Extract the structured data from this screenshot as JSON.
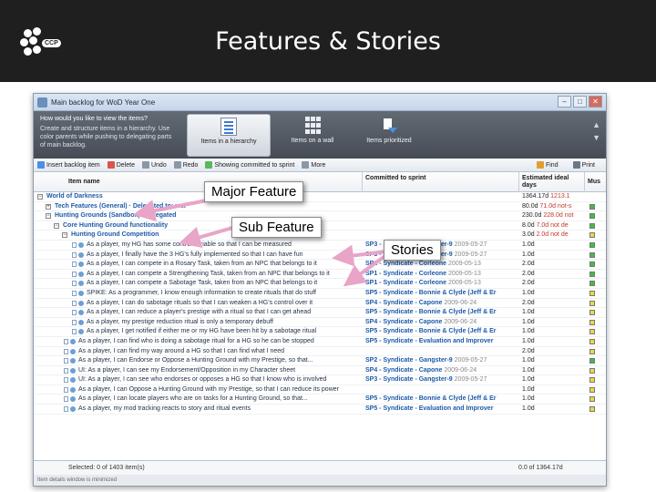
{
  "slide": {
    "title": "Features & Stories",
    "logo_text": "CCP"
  },
  "window": {
    "title": "Main backlog for WoD Year One",
    "controls": [
      "–",
      "□",
      "✕"
    ]
  },
  "ribbon": {
    "question": "How would you like to view the items?",
    "description": "Create and structure items in a hierarchy. Use color parents while pushing to delegating parts of main backlog.",
    "views": [
      {
        "label": "Items in a hierarchy",
        "icon": "hierarchy-icon",
        "active": true
      },
      {
        "label": "Items on a wall",
        "icon": "wall-icon",
        "active": false
      },
      {
        "label": "Items prioritized",
        "icon": "prioritized-icon",
        "active": false
      }
    ]
  },
  "toolbar": {
    "insert": "Insert backlog item",
    "delete": "Delete",
    "undo": "Undo",
    "redo": "Redo",
    "showing": "Showing committed to sprint",
    "more": "More",
    "find": "Find",
    "print": "Print"
  },
  "columns": {
    "item_name": "Item name",
    "committed": "Committed to sprint",
    "ideal": "Estimated ideal days",
    "must": "Mus"
  },
  "rows": [
    {
      "level": 0,
      "name": "World of Darkness",
      "bold": true,
      "committed": "",
      "date": "",
      "ideal": "1364.17d",
      "ideal_extra": "1213.1",
      "status": "",
      "expander": "−",
      "kind": "group"
    },
    {
      "level": 1,
      "name": "Tech Features (General)",
      "extra": "Delegated to: xxx",
      "bold": true,
      "committed": "",
      "date": "",
      "ideal": "80.0d",
      "ideal_extra": "71.0d not-s",
      "status": "#3fbf3f",
      "expander": "+",
      "kind": "group"
    },
    {
      "level": 1,
      "name": "Hunting Grounds (Sandbox)",
      "extra": "Delegated",
      "bold": true,
      "committed": "",
      "date": "",
      "ideal": "230.0d",
      "ideal_extra": "228.0d not",
      "status": "#3fbf3f",
      "expander": "−",
      "kind": "group"
    },
    {
      "level": 2,
      "name": "Core Hunting Ground functionality",
      "bold": true,
      "committed": "",
      "date": "",
      "ideal": "8.0d",
      "ideal_extra": "7.0d not de",
      "status": "#3fbf3f",
      "expander": "−",
      "kind": "group"
    },
    {
      "level": 3,
      "name": "Hunting Ground Competition",
      "bold": true,
      "committed": "",
      "date": "",
      "ideal": "3.0d",
      "ideal_extra": "2.0d not de",
      "status": "#e8d94a",
      "expander": "−",
      "kind": "group"
    },
    {
      "level": 4,
      "name": "As a player, my HG has some control variable so that I can be measured",
      "committed": "SP3 - Syndicate - Gangster-9",
      "date": "2009-05-27",
      "ideal": "1.0d",
      "status": "#3fbf3f",
      "kind": "story"
    },
    {
      "level": 4,
      "name": "As a player, I finally have the 3 HG's fully implemented so that I can have fun",
      "committed": "SP3 - Syndicate - Gangster-9",
      "date": "2009-05-27",
      "ideal": "1.0d",
      "status": "#3fbf3f",
      "kind": "story"
    },
    {
      "level": 4,
      "name": "As a player, I can compete in a Rosary Task, taken from an NPC that belongs to it",
      "committed": "SP1 - Syndicate - Corleone",
      "date": "2009-05-13",
      "ideal": "2.0d",
      "status": "#3fbf3f",
      "kind": "story"
    },
    {
      "level": 4,
      "name": "As a player, I can compete a Strengthening Task, taken from an NPC that belongs to it",
      "committed": "SP1 - Syndicate - Corleone",
      "date": "2009-05-13",
      "ideal": "2.0d",
      "status": "#3fbf3f",
      "kind": "story"
    },
    {
      "level": 4,
      "name": "As a player, I can compete a Sabotage Task, taken from an NPC that belongs to it",
      "committed": "SP1 - Syndicate - Corleone",
      "date": "2009-05-13",
      "ideal": "2.0d",
      "status": "#3fbf3f",
      "kind": "story"
    },
    {
      "level": 4,
      "name": "SPIKE: As a programmer, I know enough information to create rituals that do stuff",
      "committed": "SP5 - Syndicate - Bonnie & Clyde (Jeff & Er",
      "date": "",
      "ideal": "1.0d",
      "status": "#e8d94a",
      "kind": "story"
    },
    {
      "level": 4,
      "name": "As a player, I can do sabotage rituals so that I can weaken a HG's control over it",
      "committed": "SP4 - Syndicate - Capone",
      "date": "2009-06-24",
      "ideal": "2.0d",
      "status": "#e8d94a",
      "kind": "story"
    },
    {
      "level": 4,
      "name": "As a player, I can reduce a player's prestige with a ritual so that I can get ahead",
      "committed": "SP5 - Syndicate - Bonnie & Clyde (Jeff & Er",
      "date": "",
      "ideal": "1.0d",
      "status": "#e8d94a",
      "kind": "story"
    },
    {
      "level": 4,
      "name": "As a player, my prestige reduction ritual is only a temporary debuff",
      "committed": "SP4 - Syndicate - Capone",
      "date": "2009-06-24",
      "ideal": "1.0d",
      "status": "#e8d94a",
      "kind": "story"
    },
    {
      "level": 4,
      "name": "As a player, I get notified if either me or my HG have been hit by a sabotage ritual",
      "committed": "SP5 - Syndicate - Bonnie & Clyde (Jeff & Er",
      "date": "",
      "ideal": "1.0d",
      "status": "#e8d94a",
      "kind": "story"
    },
    {
      "level": 3,
      "name": "As a player, I can find who is doing a sabotage ritual for a HG so he can be stopped",
      "committed": "SP5 - Syndicate - Evaluation and Improver",
      "date": "",
      "ideal": "1.0d",
      "status": "#e8d94a",
      "kind": "story"
    },
    {
      "level": 3,
      "name": "As a player, I can find my way around a HG so that I can find what I need",
      "committed": "",
      "date": "",
      "ideal": "2.0d",
      "status": "#e8d94a",
      "kind": "story"
    },
    {
      "level": 3,
      "name": "As a player, I can Endorse or Oppose a Hunting Ground with my Prestige, so that...",
      "committed": "SP2 - Syndicate - Gangster-9",
      "date": "2009-05-27",
      "ideal": "1.0d",
      "status": "#3fbf3f",
      "kind": "story"
    },
    {
      "level": 3,
      "name": "UI: As a player, I can see my Endorsement/Opposition in my Character sheet",
      "committed": "SP4 - Syndicate - Capone",
      "date": "2009-06-24",
      "ideal": "1.0d",
      "status": "#e8d94a",
      "kind": "story"
    },
    {
      "level": 3,
      "name": "UI: As a player, I can see who endorses or opposes a HG so that I know who is involved",
      "committed": "SP3 - Syndicate - Gangster-9",
      "date": "2009-05-27",
      "ideal": "1.0d",
      "status": "#e8d94a",
      "kind": "story"
    },
    {
      "level": 3,
      "name": "As a player, I can Oppose a Hunting Ground with my Prestige, so that I can reduce its power",
      "committed": "",
      "date": "",
      "ideal": "1.0d",
      "status": "#e8d94a",
      "kind": "story"
    },
    {
      "level": 3,
      "name": "As a player, I can locate players who are on tasks for a Hunting Ground, so that...",
      "committed": "SP5 - Syndicate - Bonnie & Clyde (Jeff & Er",
      "date": "",
      "ideal": "1.0d",
      "status": "#e8d94a",
      "kind": "story"
    },
    {
      "level": 3,
      "name": "As a player, my mod tracking reacts to story and ritual events",
      "committed": "SP5 - Syndicate - Evaluation and Improver",
      "date": "",
      "ideal": "1.0d",
      "status": "#e8d94a",
      "kind": "story"
    }
  ],
  "footer": {
    "selected": "Selected: 0 of 1403 item(s)",
    "totals": "0.0 of 1364.17d",
    "status_line": "Item details window is minimized"
  },
  "callouts": {
    "major_feature": "Major Feature",
    "sub_feature": "Sub Feature",
    "stories": "Stories"
  },
  "colors": {
    "header_bg": "#1f1f1f",
    "arrow": "#e8a5c8",
    "link_blue": "#1d5aa8",
    "status_green": "#3fbf3f",
    "status_yellow": "#e8d94a"
  }
}
